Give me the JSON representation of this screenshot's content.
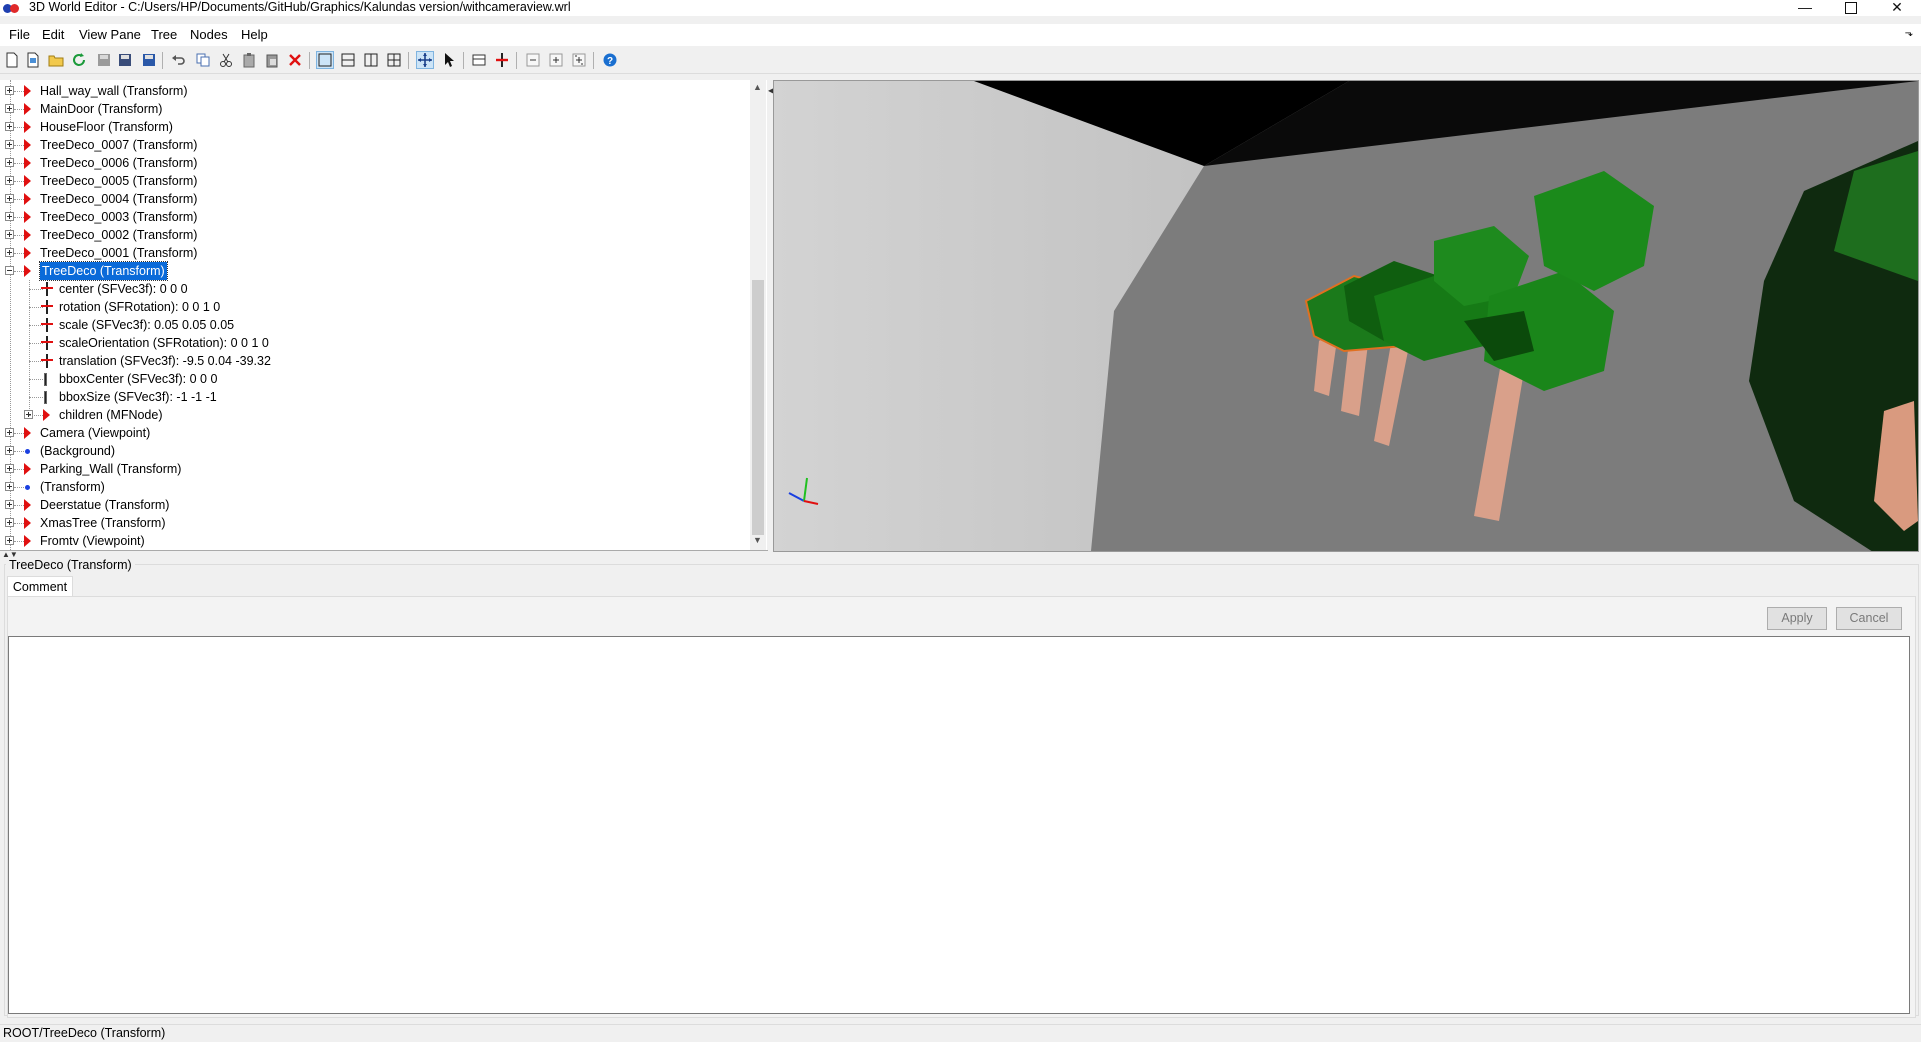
{
  "window": {
    "title": "3D World Editor - C:/Users/HP/Documents/GitHub/Graphics/Kalundas version/withcameraview.wrl",
    "minimize": "—",
    "close": "✕"
  },
  "menu": [
    "File",
    "Edit",
    "View Pane",
    "Tree",
    "Nodes",
    "Help"
  ],
  "menu_corner": "⬎",
  "toolbar": {
    "icons": [
      "new-file-icon",
      "new-template-icon",
      "open-folder-icon",
      "reload-icon",
      "save-disabled-icon",
      "save-as-icon",
      "save-all-icon",
      "undo-icon",
      "copy-icon",
      "cut-icon",
      "paste-icon",
      "paste-special-icon",
      "delete-icon",
      "single-view-icon",
      "split-horizontal-icon",
      "split-vertical-icon",
      "quad-view-icon",
      "move-tool-icon",
      "pointer-tool-icon",
      "route-icon",
      "insert-node-icon",
      "zoom-out-icon",
      "zoom-in-icon",
      "zoom-fit-icon",
      "help-icon"
    ],
    "accent": "#1a6fd0"
  },
  "tree": {
    "nodes": [
      {
        "label": "Hall_way_wall (Transform)",
        "icon": "triangle"
      },
      {
        "label": "MainDoor (Transform)",
        "icon": "triangle"
      },
      {
        "label": "HouseFloor (Transform)",
        "icon": "triangle"
      },
      {
        "label": "TreeDeco_0007 (Transform)",
        "icon": "triangle"
      },
      {
        "label": "TreeDeco_0006 (Transform)",
        "icon": "triangle"
      },
      {
        "label": "TreeDeco_0005 (Transform)",
        "icon": "triangle"
      },
      {
        "label": "TreeDeco_0004 (Transform)",
        "icon": "triangle"
      },
      {
        "label": "TreeDeco_0003 (Transform)",
        "icon": "triangle"
      },
      {
        "label": "TreeDeco_0002 (Transform)",
        "icon": "triangle"
      },
      {
        "label": "TreeDeco_0001 (Transform)",
        "icon": "triangle"
      },
      {
        "label": "TreeDeco (Transform)",
        "icon": "triangle",
        "selected": true,
        "expanded": true
      },
      {
        "label": "center (SFVec3f): 0  0  0",
        "icon": "field",
        "child": true
      },
      {
        "label": "rotation (SFRotation): 0  0  1  0",
        "icon": "field",
        "child": true
      },
      {
        "label": "scale (SFVec3f): 0.05        0.05        0.05",
        "icon": "field",
        "child": true
      },
      {
        "label": "scaleOrientation (SFRotation): 0  0  1  0",
        "icon": "field",
        "child": true
      },
      {
        "label": "translation (SFVec3f): -9.5        0.04       -39.32",
        "icon": "field",
        "child": true
      },
      {
        "label": "bboxCenter (SFVec3f): 0  0  0",
        "icon": "bar",
        "child": true
      },
      {
        "label": "bboxSize (SFVec3f): -1 -1 -1",
        "icon": "bar",
        "child": true
      },
      {
        "label": "children (MFNode)",
        "icon": "triangle",
        "child": true,
        "expander": true
      },
      {
        "label": "Camera (Viewpoint)",
        "icon": "triangle"
      },
      {
        "label": " (Background)",
        "icon": "dot"
      },
      {
        "label": "Parking_Wall (Transform)",
        "icon": "triangle"
      },
      {
        "label": " (Transform)",
        "icon": "dot"
      },
      {
        "label": "Deerstatue (Transform)",
        "icon": "triangle"
      },
      {
        "label": "XmasTree (Transform)",
        "icon": "triangle"
      },
      {
        "label": "Fromtv (Viewpoint)",
        "icon": "triangle"
      }
    ],
    "selection_color": "#0a6ad9"
  },
  "properties": {
    "group_title": "TreeDeco (Transform)",
    "tab": "Comment",
    "apply": "Apply",
    "cancel": "Cancel",
    "comment_value": ""
  },
  "status": {
    "path": "ROOT/TreeDeco (Transform)"
  },
  "viewport": {
    "colors": {
      "wall": "#c8c8c8",
      "floor": "#7c7c7c",
      "sky": "#000000",
      "foliage": "#1e8a1e",
      "trunk": "#d9a08a"
    }
  }
}
